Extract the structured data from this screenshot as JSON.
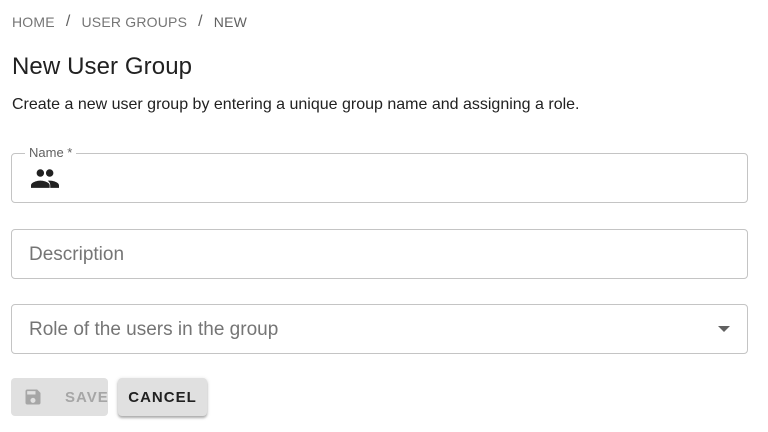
{
  "breadcrumb": {
    "items": [
      "HOME",
      "USER GROUPS",
      "NEW"
    ],
    "separator": "/"
  },
  "page": {
    "title": "New User Group",
    "subtitle": "Create a new user group by entering a unique group name and assigning a role."
  },
  "form": {
    "name": {
      "label": "Name *",
      "value": "",
      "icon": "group-icon"
    },
    "description": {
      "placeholder": "Description",
      "value": ""
    },
    "role": {
      "placeholder": "Role of the users in the group",
      "value": "",
      "icon": "chevron-down-icon"
    }
  },
  "actions": {
    "save_label": "SAVE",
    "save_disabled": true,
    "save_icon": "save-icon",
    "cancel_label": "CANCEL"
  },
  "colors": {
    "text_primary": "#212121",
    "text_secondary": "#757575",
    "border": "#c4c4c4",
    "button_bg": "#e0e0e0",
    "disabled_text": "#a6a6a6"
  }
}
